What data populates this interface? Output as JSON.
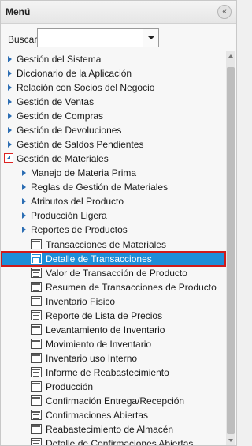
{
  "header": {
    "title": "Menú",
    "collapse_icon": "«"
  },
  "search": {
    "label": "Buscar:",
    "value": ""
  },
  "scrollbar": {
    "position": 0.0
  },
  "tree": {
    "top_items": [
      "Gestión del Sistema",
      "Diccionario de la Aplicación",
      "Relación con Socios del Negocio",
      "Gestión de Ventas",
      "Gestión de Compras",
      "Gestión de Devoluciones",
      "Gestión de Saldos Pendientes"
    ],
    "expanded_item": "Gestión de Materiales",
    "sub_folders": [
      "Manejo de Materia Prima",
      "Reglas de Gestión de Materiales",
      "Atributos del Producto",
      "Producción Ligera",
      "Reportes de Productos"
    ],
    "windows": [
      "Transacciones de Materiales",
      "Detalle de Transacciones",
      "Valor de Transacción de Producto",
      "Resumen de Transacciones de Producto",
      "Inventario Físico",
      "Reporte de Lista de Precios",
      "Levantamiento de Inventario",
      "Movimiento de Inventario",
      "Inventario uso Interno",
      "Informe de Reabastecimiento",
      "Producción",
      "Confirmación Entrega/Recepción",
      "Confirmaciones Abiertas",
      "Reabastecimiento de Almacén",
      "Detalle de Confirmaciones Abiertas"
    ],
    "selected_window": "Detalle de Transacciones",
    "colors": {
      "selection": "#1e8ed8",
      "highlight_border": "#d01a1a",
      "arrow": "#2b6db3"
    }
  }
}
